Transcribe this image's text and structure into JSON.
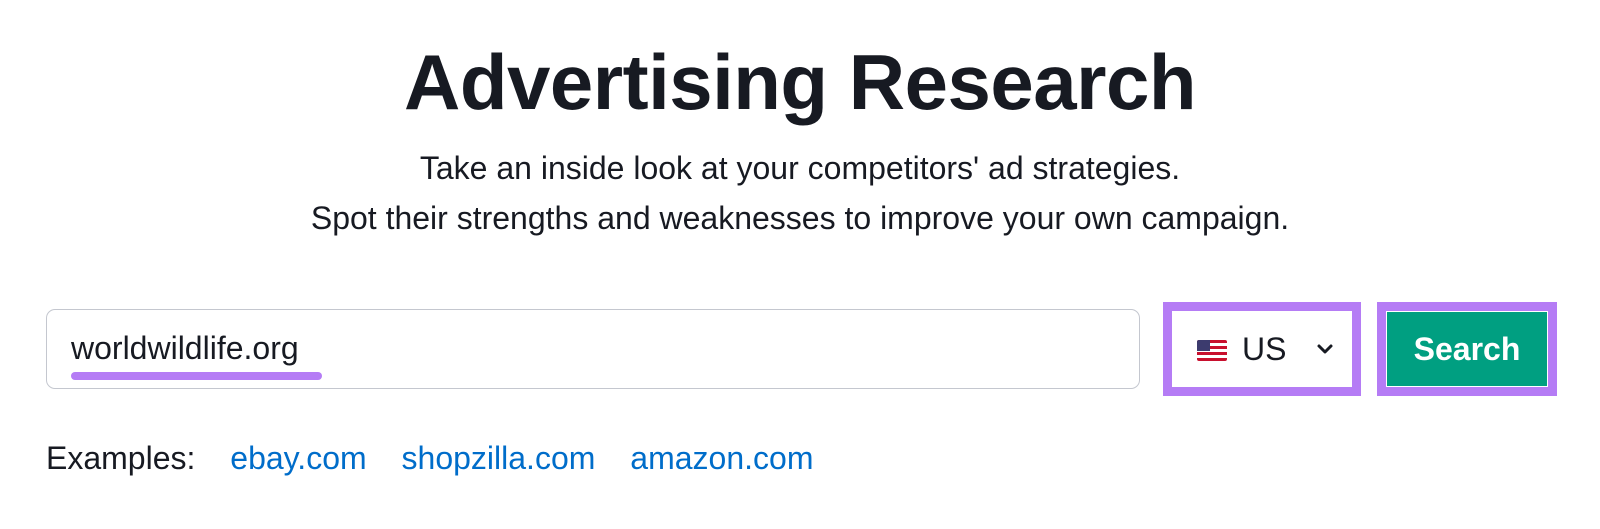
{
  "header": {
    "title": "Advertising Research",
    "subtitle_line1": "Take an inside look at your competitors' ad strategies.",
    "subtitle_line2": "Spot their strengths and weaknesses to improve your own campaign."
  },
  "search": {
    "value": "worldwildlife.org",
    "database": {
      "code": "US",
      "flag_icon": "us-flag-icon"
    },
    "button_label": "Search"
  },
  "examples": {
    "label": "Examples:",
    "links": [
      "ebay.com",
      "shopzilla.com",
      "amazon.com"
    ]
  },
  "colors": {
    "accent_highlight": "#b57cf5",
    "button": "#009f81",
    "link": "#006dca",
    "text": "#171a22"
  }
}
